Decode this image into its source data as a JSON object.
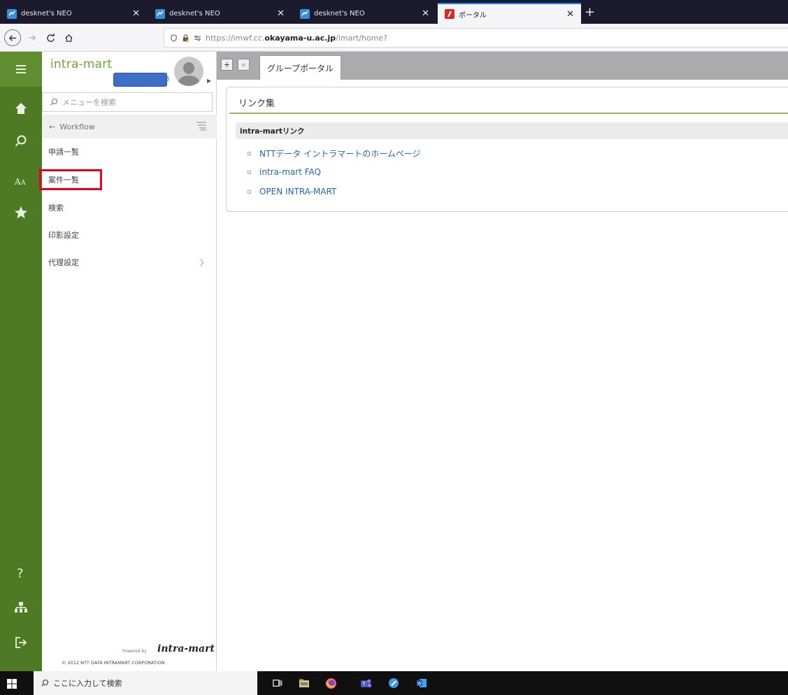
{
  "browser": {
    "tabs": [
      {
        "title": "desknet's NEO",
        "icon": "desknets-favicon-icon",
        "active": false
      },
      {
        "title": "desknet's NEO",
        "icon": "desknets-favicon-icon",
        "active": false
      },
      {
        "title": "desknet's NEO",
        "icon": "desknets-favicon-icon",
        "active": false
      },
      {
        "title": "ポータル",
        "icon": "intramart-favicon-icon",
        "active": true
      }
    ],
    "close_glyph": "✕",
    "new_tab_glyph": "+",
    "url_prefix": "https://imwf.cc.",
    "url_domain": "okayama-u.ac.jp",
    "url_path": "/imart/home?"
  },
  "app": {
    "brand": "intra-mart",
    "user_name_suffix": "3",
    "menu_search_placeholder": "メニューを検索",
    "section_back": "Workflow",
    "menu_items": [
      {
        "label": "申請一覧",
        "has_children": false
      },
      {
        "label": "案件一覧",
        "has_children": false
      },
      {
        "label": "検索",
        "has_children": false
      },
      {
        "label": "印影設定",
        "has_children": false
      },
      {
        "label": "代理設定",
        "has_children": true
      }
    ],
    "powered_by": "Powered by",
    "footer_logo": "intra-mart",
    "copyright": "© 2012 NTT DATA INTRAMART CORPORATION"
  },
  "content": {
    "toolbar": {
      "add_glyph": "+",
      "collapse_glyph": "«"
    },
    "tab_label": "グループポータル",
    "portlet": {
      "title": "リンク集",
      "subheader": "intra-martリンク",
      "links": [
        "NTTデータ イントラマートのホームページ",
        "intra-mart FAQ",
        "OPEN INTRA-MART"
      ]
    }
  },
  "taskbar": {
    "search_placeholder": "ここに入力して検索",
    "apps": [
      "task-view-icon",
      "file-explorer-icon",
      "firefox-icon",
      "teams-icon",
      "app-icon",
      "word-icon"
    ]
  },
  "colors": {
    "rail_green": "#4f7a25",
    "brand_green": "#6aa839",
    "link_blue": "#2266bb",
    "highlight_red": "#e8001c"
  }
}
